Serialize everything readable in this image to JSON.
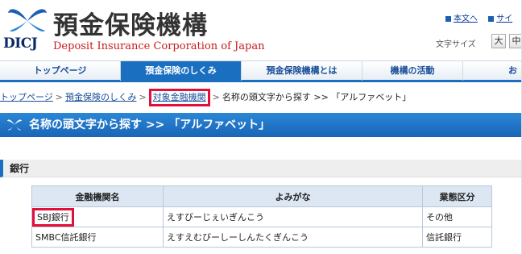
{
  "header": {
    "org_name_jp": "預金保険機構",
    "org_name_en": "Deposit Insurance Corporation of Japan",
    "logo_abbr": "DICJ",
    "util_links": [
      "本文へ",
      "サイ"
    ],
    "font_size_label": "文字サイズ",
    "font_size_buttons": [
      "大",
      "中"
    ]
  },
  "nav": {
    "tabs": [
      "トップページ",
      "預金保険のしくみ",
      "預金保険機構とは",
      "機構の活動",
      "お"
    ],
    "active_index": 1
  },
  "breadcrumb": {
    "items": [
      "トップページ",
      "預金保険のしくみ",
      "対象金融機関"
    ],
    "current": "名称の頭文字から探す >> 「アルファベット」",
    "separator": ">"
  },
  "page_title": "名称の頭文字から探す >> 「アルファベット」",
  "section": {
    "heading": "銀行"
  },
  "table": {
    "headers": [
      "金融機関名",
      "よみがな",
      "業態区分"
    ],
    "rows": [
      [
        "SBJ銀行",
        "えすびーじぇいぎんこう",
        "その他"
      ],
      [
        "SMBC信託銀行",
        "えすえむびーしーしんたくぎんこう",
        "信託銀行"
      ]
    ]
  },
  "colors": {
    "brand_blue": "#1a6fc0",
    "highlight_red": "#e0103a",
    "english_name_red": "#c81a1a"
  }
}
